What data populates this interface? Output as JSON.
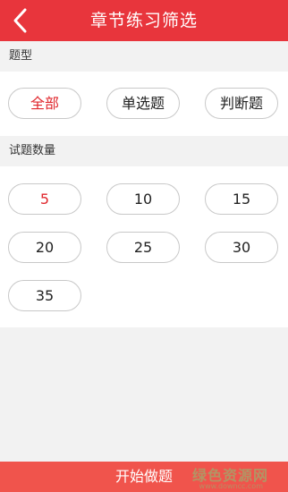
{
  "header": {
    "title": "章节练习筛选",
    "back_icon": "chevron-left-icon"
  },
  "question_type": {
    "label": "题型",
    "options": [
      "全部",
      "单选题",
      "判断题"
    ],
    "selected": "全部"
  },
  "question_count": {
    "label": "试题数量",
    "options": [
      "5",
      "10",
      "15",
      "20",
      "25",
      "30",
      "35"
    ],
    "selected": "5"
  },
  "footer": {
    "start_label": "开始做题"
  },
  "watermark": {
    "text": "绿色资源网",
    "sub": "www.downcc.com"
  },
  "colors": {
    "accent": "#e8353c",
    "selected_text": "#e0272d",
    "start_bar": "#f0544c"
  }
}
